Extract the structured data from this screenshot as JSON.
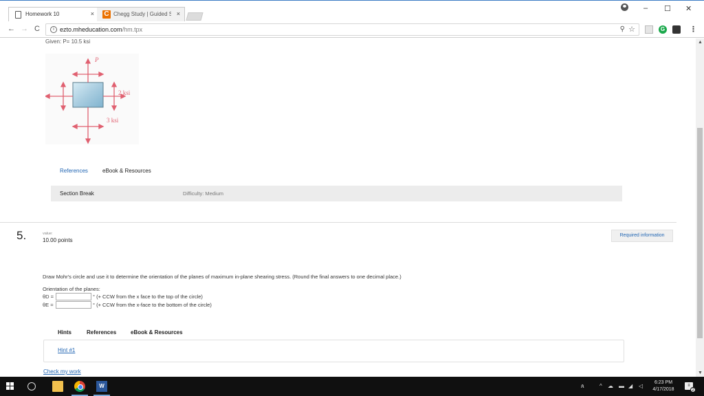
{
  "browser": {
    "tabs": [
      {
        "title": "Homework 10",
        "close": "×"
      },
      {
        "title": "Chegg Study | Guided So",
        "close": "×",
        "icon_letter": "C"
      }
    ],
    "window_controls": {
      "minimize": "–",
      "maximize": "☐",
      "close": "✕"
    },
    "url_host": "ezto.mheducation.com",
    "url_path": "/hm.tpx",
    "nav": {
      "back": "←",
      "forward": "→",
      "reload": "C"
    },
    "extensions": {
      "grammarly": "G"
    }
  },
  "problem_prev": {
    "given_text": "Given: P= 10.5 ksi",
    "figure_labels": {
      "p": "P",
      "right": "2 ksi",
      "bottom": "3 ksi"
    },
    "tabs": {
      "references": "References",
      "ebook": "eBook & Resources"
    },
    "section_break": "Section Break",
    "difficulty": "Difficulty: Medium"
  },
  "question": {
    "number": "5.",
    "value_label": "value:",
    "points": "10.00 points",
    "required_button": "Required information",
    "prompt": "Draw Mohr's circle and use it to determine the orientation of the planes of maximum in-plane shearing stress. (Round the final answers to one decimal place.)",
    "orientation_label": "Orientation of the planes:",
    "answers": [
      {
        "symbol": "θD =",
        "value": "",
        "unit": "° (+ CCW from the x face to the top of the circle)"
      },
      {
        "symbol": "θE =",
        "value": "",
        "unit": "° (+ CCW from the x-face to the bottom of the circle)"
      }
    ],
    "tabs": {
      "hints": "Hints",
      "references": "References",
      "ebook": "eBook & Resources"
    },
    "hint_link": "Hint #1",
    "check_link": "Check my work"
  },
  "taskbar": {
    "word_label": "W",
    "tray": {
      "people": "ጰ",
      "up": "^",
      "time": "6:23 PM",
      "date": "4/17/2018",
      "notifications": "2"
    }
  },
  "colors": {
    "link": "#2266b3",
    "arrow_red": "#e06070",
    "square_blue": "#a9cde0"
  }
}
